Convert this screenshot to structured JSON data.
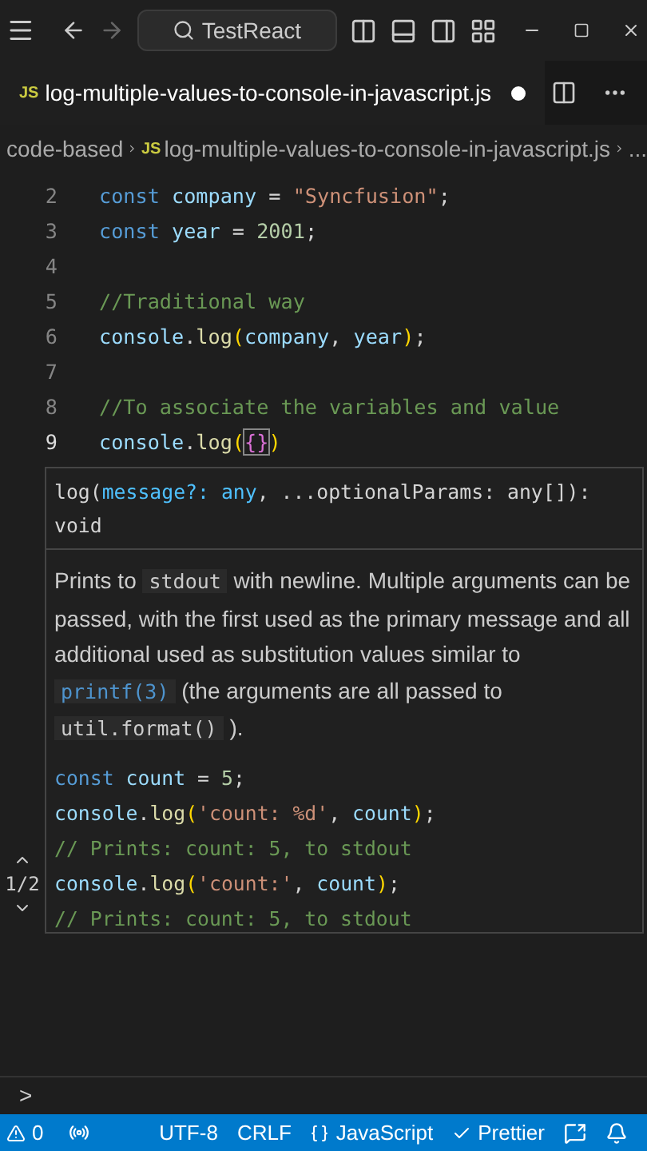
{
  "title_bar": {
    "search": "TestReact"
  },
  "tab": {
    "badge": "JS",
    "label": "log-multiple-values-to-console-in-javascript.js",
    "modified": true
  },
  "breadcrumb": {
    "folder": "code-based",
    "badge": "JS",
    "file": "log-multiple-values-to-console-in-javascript.js",
    "more": "..."
  },
  "editor_lines": [
    {
      "number": "2",
      "current": false,
      "tokens": [
        {
          "kind": "keyword",
          "text": "const "
        },
        {
          "kind": "variable",
          "text": "company"
        },
        {
          "kind": "plain",
          "text": " = "
        },
        {
          "kind": "string",
          "text": "\"Syncfusion\""
        },
        {
          "kind": "plain",
          "text": ";"
        }
      ]
    },
    {
      "number": "3",
      "current": false,
      "tokens": [
        {
          "kind": "keyword",
          "text": "const "
        },
        {
          "kind": "variable",
          "text": "year"
        },
        {
          "kind": "plain",
          "text": " = "
        },
        {
          "kind": "number",
          "text": "2001"
        },
        {
          "kind": "plain",
          "text": ";"
        }
      ]
    },
    {
      "number": "4",
      "current": false
    },
    {
      "number": "5",
      "current": false,
      "tokens": [
        {
          "kind": "comment",
          "text": "//Traditional way"
        }
      ]
    },
    {
      "number": "6",
      "current": false,
      "tokens": [
        {
          "kind": "variable",
          "text": "console"
        },
        {
          "kind": "plain",
          "text": "."
        },
        {
          "kind": "func",
          "text": "log"
        },
        {
          "kind": "bracket",
          "text": "("
        },
        {
          "kind": "variable",
          "text": "company"
        },
        {
          "kind": "plain",
          "text": ", "
        },
        {
          "kind": "variable",
          "text": "year"
        },
        {
          "kind": "bracket",
          "text": ")"
        },
        {
          "kind": "plain",
          "text": ";"
        }
      ]
    },
    {
      "number": "7",
      "current": false
    },
    {
      "number": "8",
      "current": false,
      "tokens": [
        {
          "kind": "comment",
          "text": "//To associate the variables and value"
        }
      ]
    },
    {
      "number": "9",
      "current": true,
      "tokens": [
        {
          "kind": "variable",
          "text": "console"
        },
        {
          "kind": "plain",
          "text": "."
        },
        {
          "kind": "func",
          "text": "log"
        },
        {
          "kind": "bracket",
          "text": "("
        },
        {
          "kind": "brace",
          "text": "{}"
        },
        {
          "kind": "bracket",
          "text": ")"
        }
      ]
    }
  ],
  "hover": {
    "signature": [
      {
        "kind": "plain",
        "text": "log("
      },
      {
        "kind": "param",
        "text": "message?: any"
      },
      {
        "kind": "plain",
        "text": ", ...optionalParams: any[]): void"
      }
    ],
    "description": [
      {
        "kind": "text",
        "text": "Prints to "
      },
      {
        "kind": "code",
        "text": "stdout"
      },
      {
        "kind": "text",
        "text": " with newline. Multiple arguments can be passed, with the first used as the primary message and all additional used as substitution values similar to "
      },
      {
        "kind": "link",
        "text": "printf(3)"
      },
      {
        "kind": "text",
        "text": " (the arguments are all passed to "
      },
      {
        "kind": "code",
        "text": "util.format()"
      },
      {
        "kind": "text",
        "text": " )."
      }
    ],
    "example": [
      [
        {
          "kind": "keyword",
          "text": "const "
        },
        {
          "kind": "variable",
          "text": "count"
        },
        {
          "kind": "plain",
          "text": " = "
        },
        {
          "kind": "number",
          "text": "5"
        },
        {
          "kind": "plain",
          "text": ";"
        }
      ],
      [
        {
          "kind": "variable",
          "text": "console"
        },
        {
          "kind": "plain",
          "text": "."
        },
        {
          "kind": "func",
          "text": "log"
        },
        {
          "kind": "bracket",
          "text": "("
        },
        {
          "kind": "string",
          "text": "'count: %d'"
        },
        {
          "kind": "plain",
          "text": ", "
        },
        {
          "kind": "variable",
          "text": "count"
        },
        {
          "kind": "bracket",
          "text": ")"
        },
        {
          "kind": "plain",
          "text": ";"
        }
      ],
      [
        {
          "kind": "comment",
          "text": "// Prints: count: 5, to stdout"
        }
      ],
      [
        {
          "kind": "variable",
          "text": "console"
        },
        {
          "kind": "plain",
          "text": "."
        },
        {
          "kind": "func",
          "text": "log"
        },
        {
          "kind": "bracket",
          "text": "("
        },
        {
          "kind": "string",
          "text": "'count:'"
        },
        {
          "kind": "plain",
          "text": ", "
        },
        {
          "kind": "variable",
          "text": "count"
        },
        {
          "kind": "bracket",
          "text": ")"
        },
        {
          "kind": "plain",
          "text": ";"
        }
      ],
      [
        {
          "kind": "comment",
          "text": "// Prints: count: 5, to stdout"
        }
      ]
    ],
    "overload": "1/2"
  },
  "terminal": {
    "prompt": ">"
  },
  "status_bar": {
    "problems": "0",
    "items": [
      {
        "kind": "text",
        "label": "UTF-8"
      },
      {
        "kind": "text",
        "label": "CRLF"
      },
      {
        "kind": "language",
        "label": "JavaScript"
      },
      {
        "kind": "check",
        "label": "Prettier"
      }
    ]
  }
}
